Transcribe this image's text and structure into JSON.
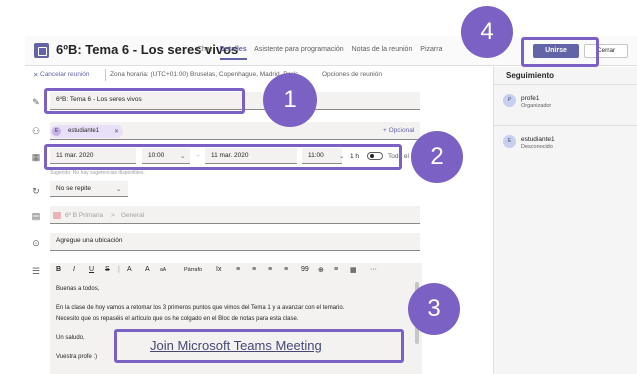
{
  "header": {
    "title": "6ºB: Tema 6 - Los seres vivos",
    "tabs": [
      "Chat",
      "Detalles",
      "Asistente para programación",
      "Notas de la reunión",
      "Pizarra"
    ],
    "active_tab": "Detalles",
    "join_label": "Unirse",
    "close_label": "Cerrar"
  },
  "subbar": {
    "cancel_label": "Cancelar reunión",
    "timezone": "Zona horaria: (UTC+01:00) Bruselas, Copenhague, Madrid, París",
    "options_label": "Opciones de reunión"
  },
  "form": {
    "title_value": "6ºB: Tema 6 - Los seres vivos",
    "attendee": {
      "initial": "E",
      "name": "estudiante1"
    },
    "optional_label": "+ Opcional",
    "start_date": "11 mar. 2020",
    "start_time": "10:00",
    "end_date": "11 mar. 2020",
    "end_time": "11:00",
    "duration": "1 h",
    "all_day_label": "Todo el día",
    "suggestion": "Sugerido: No hay sugerencias disponibles.",
    "repeat_value": "No se repite",
    "channel": {
      "team": "6º B Primaria",
      "separator": ">",
      "name": "General"
    },
    "location_placeholder": "Agregue una ubicación"
  },
  "editor": {
    "toolbar": [
      "B",
      "I",
      "U",
      "S",
      "|",
      "A",
      "A",
      "Párrafo",
      "Ix",
      "≡",
      "≡",
      "≡",
      "≡",
      "99",
      "⊕",
      "≡",
      "▦",
      "···"
    ],
    "lines": [
      "Buenas a todos,",
      "En la clase de hoy vamos a retomar los 3 primeros puntos que vimos del Tema 1 y a avanzar con el temario.",
      "Necesito que os repaséis el artículo que os he colgado en el Bloc de notas para esta clase.",
      "Un saludo,",
      "Vuestra profe :)"
    ],
    "join_link": "Join Microsoft Teams Meeting"
  },
  "tracking": {
    "title": "Seguimiento",
    "people": [
      {
        "initial": "P",
        "name": "profe1",
        "role": "Organizador"
      },
      {
        "initial": "E",
        "name": "estudiante1",
        "role": "Desconocido"
      }
    ]
  },
  "callouts": [
    "1",
    "2",
    "3",
    "4"
  ],
  "colors": {
    "accent": "#6264a7",
    "callout": "#7b61c3"
  }
}
